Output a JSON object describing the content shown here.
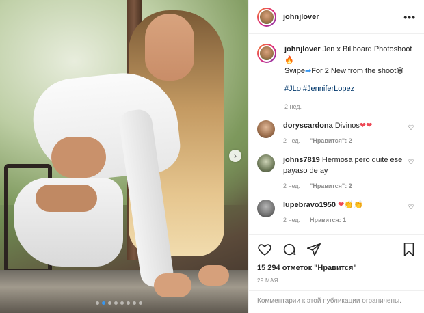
{
  "header": {
    "username": "johnjlover",
    "more_label": "•••"
  },
  "caption": {
    "username": "johnjlover",
    "line1": "Jen x Billboard Photoshoot",
    "line1_emoji": "🔥",
    "line2_a": "Swipe",
    "line2_emoji_a": "➡",
    "line2_b": "For 2 New from the shoot",
    "line2_emoji_b": "😁",
    "tags": "#JLo #JenniferLopez",
    "time": "2 нед."
  },
  "comments": [
    {
      "username": "doryscardona",
      "text": "Divinos",
      "emoji": "❤❤",
      "time": "2 нед.",
      "likes": "\"Нравится\": 2"
    },
    {
      "username": "johns7819",
      "text": "Hermosa pero quite ese payaso de ay",
      "emoji": "",
      "time": "2 нед.",
      "likes": "\"Нравится\": 2"
    },
    {
      "username": "lupebravo1950",
      "text": "",
      "emoji": "❤👏👏",
      "time": "2 нед.",
      "likes": "Нравится: 1"
    }
  ],
  "footer": {
    "likes_text": "15 294 отметок \"Нравится\"",
    "date": "29 МАЯ",
    "comments_disabled": "Комментарии к этой публикации ограничены."
  },
  "carousel": {
    "dots": 8,
    "active": 1,
    "next_icon": "chevron-right-icon"
  },
  "colors": {
    "link": "#00376b",
    "accent": "#3897f0",
    "muted": "#8e8e8e"
  }
}
